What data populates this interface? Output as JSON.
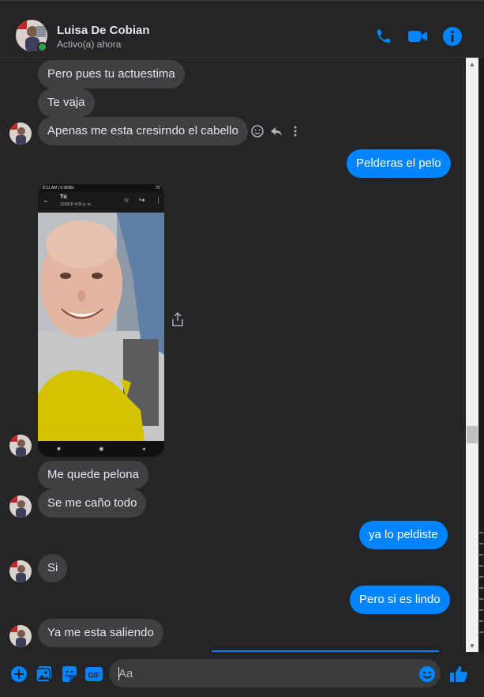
{
  "header": {
    "name": "Luisa De Cobian",
    "status": "Activo(a) ahora"
  },
  "colors": {
    "accent": "#0084ff",
    "online": "#31a24c",
    "incoming_bubble": "#3e4042",
    "background": "#242526"
  },
  "icons": {
    "call": "phone-icon",
    "video": "video-camera-icon",
    "info": "info-icon",
    "add": "plus-icon",
    "photo": "image-icon",
    "sticker": "sticker-icon",
    "gif": "gif-icon",
    "emoji": "emoji-icon",
    "like": "thumbs-up-icon"
  },
  "messages": [
    {
      "from": "them",
      "text": "Pero pues tu actuestima"
    },
    {
      "from": "them",
      "text": "Te vaja"
    },
    {
      "from": "them",
      "text": "Apenas me esta cresirndo el cabello"
    },
    {
      "from": "me",
      "text": "Pelderas el pelo"
    },
    {
      "from": "them",
      "type": "image"
    },
    {
      "from": "them",
      "text": "Me quede pelona"
    },
    {
      "from": "them",
      "text": "Se me caño todo"
    },
    {
      "from": "me",
      "text": "ya lo peldiste"
    },
    {
      "from": "them",
      "text": "Si"
    },
    {
      "from": "me",
      "text": "Pero si es lindo"
    },
    {
      "from": "them",
      "text": "Ya me esta saliendo"
    }
  ],
  "photo": {
    "status_left": "8:21 AM | 0.0KB/s",
    "status_right": "79",
    "title": "Tú",
    "subtitle": "12/8/18 4:05 p. m."
  },
  "gif_label": "GIF",
  "composer": {
    "placeholder": "Aa"
  }
}
